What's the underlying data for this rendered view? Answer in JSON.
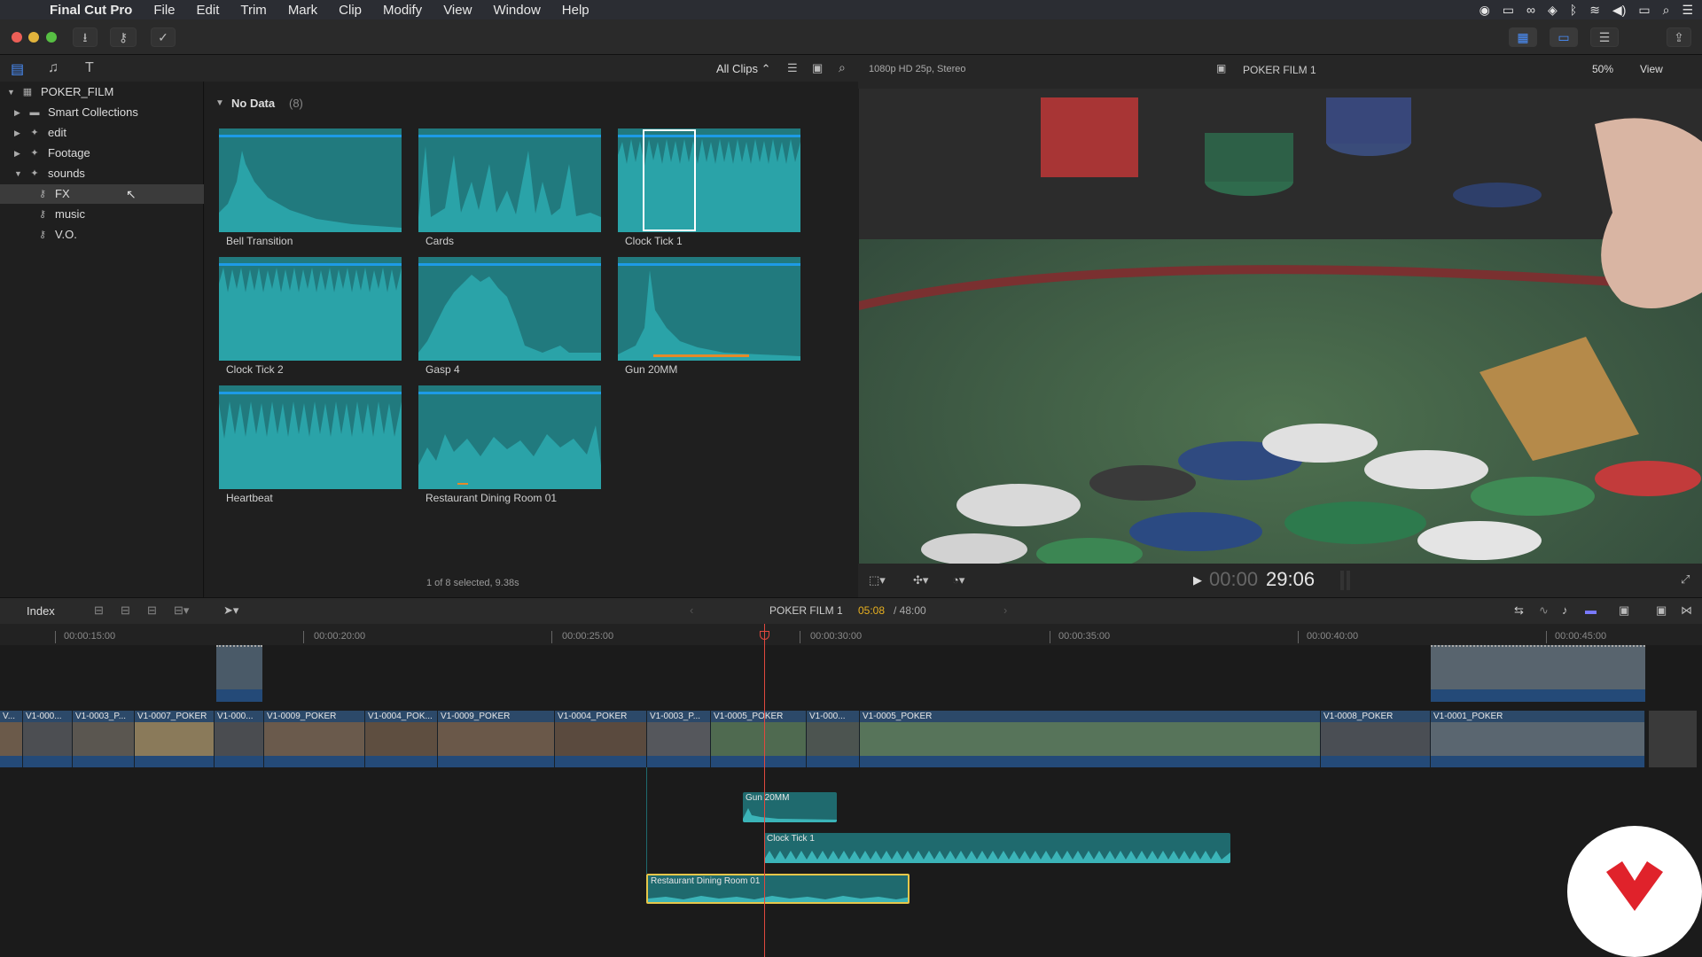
{
  "menubar": {
    "app_name": "Final Cut Pro",
    "items": [
      "File",
      "Edit",
      "Trim",
      "Mark",
      "Clip",
      "Modify",
      "View",
      "Window",
      "Help"
    ]
  },
  "browser_header": {
    "filter": "All Clips ⌃"
  },
  "library": {
    "root": "POKER_FILM",
    "items": [
      {
        "label": "Smart Collections",
        "icon": "folder-icon"
      },
      {
        "label": "edit",
        "icon": "event-star-icon"
      },
      {
        "label": "Footage",
        "icon": "event-star-icon"
      },
      {
        "label": "sounds",
        "icon": "event-star-icon"
      },
      {
        "label": "FX",
        "icon": "keyword-icon"
      },
      {
        "label": "music",
        "icon": "keyword-icon"
      },
      {
        "label": "V.O.",
        "icon": "keyword-icon"
      }
    ]
  },
  "browser": {
    "group_title": "No Data",
    "group_count": "(8)",
    "clips": [
      "Bell Transition",
      "Cards",
      "Clock Tick 1",
      "Clock Tick 2",
      "Gasp 4",
      "Gun 20MM",
      "Heartbeat",
      "Restaurant Dining Room 01"
    ],
    "status": "1 of 8 selected, 9.38s"
  },
  "viewer": {
    "format": "1080p HD 25p, Stereo",
    "title": "POKER FILM 1",
    "zoom": "50%",
    "view_label": "View",
    "timecode_dim": "00:00",
    "timecode": "29:06"
  },
  "timeline": {
    "index_label": "Index",
    "project": "POKER FILM 1",
    "position": "05:08",
    "duration": "/ 48:00",
    "ruler": [
      "00:00:15:00",
      "00:00:20:00",
      "00:00:25:00",
      "00:00:30:00",
      "00:00:35:00",
      "00:00:40:00",
      "00:00:45:00"
    ],
    "video_clips": [
      "V...",
      "V1-000...",
      "V1-0003_P...",
      "V1-0007_POKER",
      "V1-000...",
      "V1-0009_POKER",
      "V1-0004_POK...",
      "V1-0009_POKER",
      "V1-0004_POKER",
      "V1-0003_P...",
      "V1-0005_POKER",
      "V1-000...",
      "V1-0005_POKER",
      "V1-0008_POKER",
      "V1-0001_POKER"
    ],
    "audio_clips": [
      "Gun 20MM",
      "Clock Tick 1",
      "Restaurant Dining Room 01"
    ]
  },
  "colors": {
    "accent": "#1d9be6",
    "audio": "#217a7e",
    "playhead": "#e0483e",
    "selection": "#e5c64a"
  }
}
